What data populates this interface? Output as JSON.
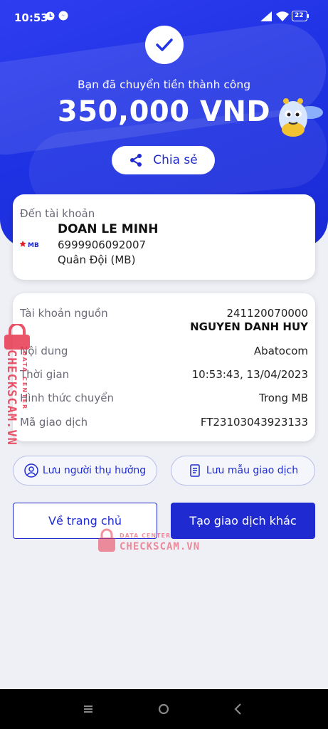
{
  "status_bar": {
    "time": "10:53",
    "battery": "22"
  },
  "hero": {
    "success_text": "Bạn đã chuyển tiền thành công",
    "amount": "350,000 VND",
    "share_label": "Chia sẻ"
  },
  "destination": {
    "label": "Đến tài khoản",
    "bank_logo": "MB",
    "name": "DOAN LE MINH",
    "account_number": "6999906092007",
    "bank_name": "Quân Đội (MB)"
  },
  "details": {
    "source_label": "Tài khoản nguồn",
    "source_account": "241120070000",
    "source_name": "NGUYEN DANH HUY",
    "content_label": "Nội dung",
    "content_value": "Abatocom",
    "time_label": "Thời gian",
    "time_value": "10:53:43, 13/04/2023",
    "method_label": "Hình thức chuyển",
    "method_value": "Trong MB",
    "txn_label": "Mã giao dịch",
    "txn_value": "FT23103043923133"
  },
  "actions": {
    "save_beneficiary": "Lưu người thụ hưởng",
    "save_template": "Lưu mẫu giao dịch",
    "home": "Về trang chủ",
    "new_txn": "Tạo giao dịch khác"
  },
  "watermark": {
    "side_text": "CHECKSCAM.VN",
    "side_sub": "DATA CENTER",
    "center_sub": "DATA CENTER",
    "center_text": "CHECKSCAM.VN"
  },
  "colors": {
    "brand": "#1f2bd0",
    "hero": "#2236e6",
    "watermark": "#e8384f"
  },
  "icons": [
    "check-icon",
    "share-icon",
    "person-icon",
    "document-icon",
    "lock-icon",
    "wifi-icon",
    "signal-icon",
    "battery-icon"
  ]
}
